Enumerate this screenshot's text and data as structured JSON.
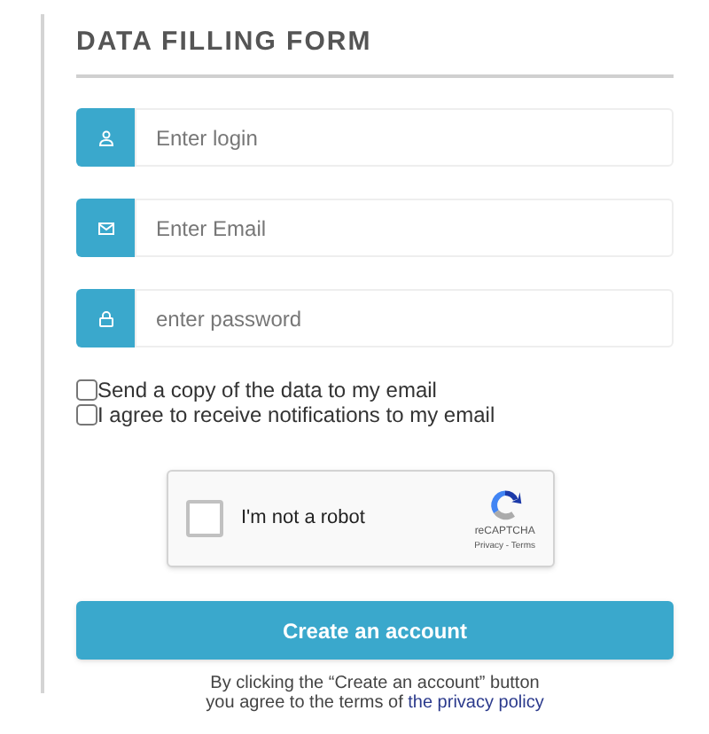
{
  "title": "DATA FILLING FORM",
  "fields": [
    {
      "kind": "login",
      "placeholder": "Enter login"
    },
    {
      "kind": "email",
      "placeholder": "Enter Email"
    },
    {
      "kind": "password",
      "placeholder": "enter password"
    }
  ],
  "checkboxes": [
    {
      "label": "Send a copy of the data to my email",
      "checked": false
    },
    {
      "label": "I agree to receive notifications to my email",
      "checked": false
    }
  ],
  "captcha": {
    "label": "I'm not a robot",
    "checked": false,
    "brand": "reCAPTCHA",
    "links": "Privacy - Terms"
  },
  "submit": "Create an account",
  "note": {
    "line1": "By clicking the “Create an account” button",
    "line2": "you agree to the terms of ",
    "link": "the privacy policy"
  }
}
